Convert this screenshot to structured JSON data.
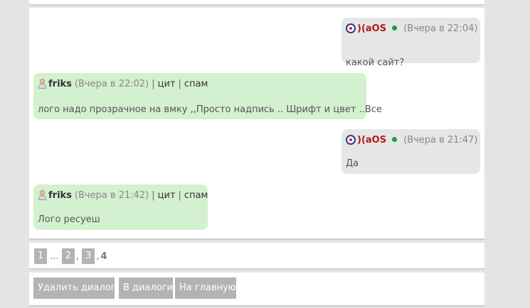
{
  "messages": [
    {
      "author": ")(aOS",
      "time": "(Вчера в 22:04)",
      "text": "какой сайт?"
    },
    {
      "author": "friks",
      "time": "(Вчера в 22:02)",
      "actions": [
        "цит",
        "спам"
      ],
      "separator": "|",
      "text": "лого надо прозрачное на вмку ,,Просто надпись .. Шрифт и цвет ..Все"
    },
    {
      "author": ")(aOS",
      "time": "(Вчера в 21:47)",
      "text": "Да"
    },
    {
      "author": "friks",
      "time": "(Вчера в 21:42)",
      "actions": [
        "цит",
        "спам"
      ],
      "separator": "|",
      "text": "Лого ресуеш"
    }
  ],
  "pagination": {
    "pages": [
      "1",
      "2",
      "3"
    ],
    "ellipsis": "...",
    "comma": ",",
    "current": "4"
  },
  "actions": {
    "delete_dialog": "Удалить диалог",
    "to_dialogs": "В диалоги",
    "to_home": "На главную"
  },
  "colors": {
    "my_bubble": "#e6e6e6",
    "their_bubble": "#d3f0d0",
    "author_aos": "#b01a1a",
    "online": "#1a9a4a",
    "button_bg": "#b3b3b3"
  }
}
